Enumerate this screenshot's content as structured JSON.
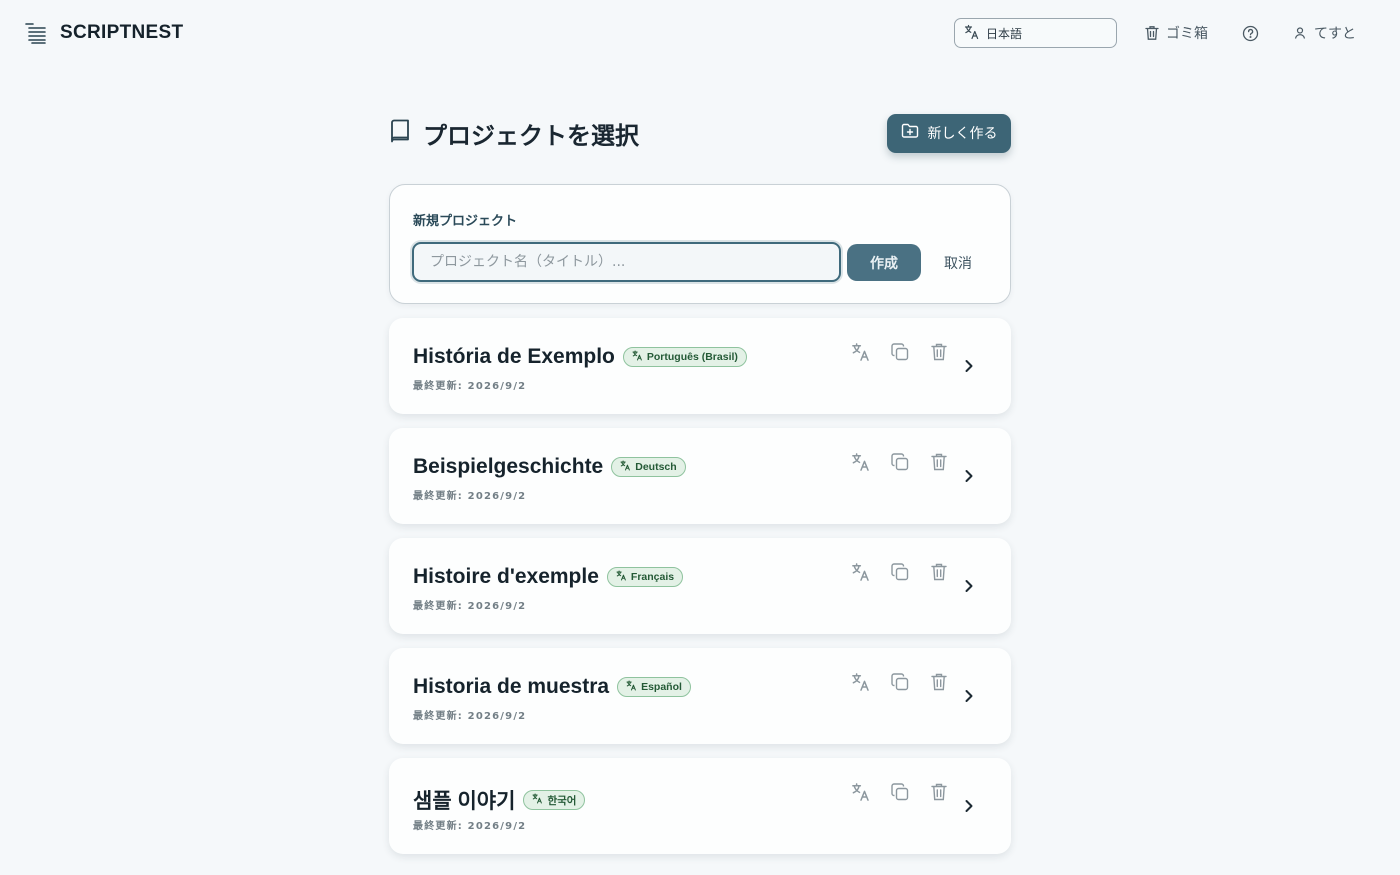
{
  "header": {
    "app_name": "SCRIPTNEST",
    "language_select": {
      "value": "日本語"
    },
    "trash_label": "ゴミ箱",
    "user_label": "てすと"
  },
  "page": {
    "title": "プロジェクトを選択",
    "new_button_label": "新しく作る"
  },
  "new_project": {
    "label": "新規プロジェクト",
    "input_placeholder": "プロジェクト名（タイトル）...",
    "input_value": "",
    "create_label": "作成",
    "cancel_label": "取消"
  },
  "projects": [
    {
      "title": "História de Exemplo",
      "language": "Português (Brasil)",
      "updated": "最終更新: 2026/9/2"
    },
    {
      "title": "Beispielgeschichte",
      "language": "Deutsch",
      "updated": "最終更新: 2026/9/2"
    },
    {
      "title": "Histoire d'exemple",
      "language": "Français",
      "updated": "最終更新: 2026/9/2"
    },
    {
      "title": "Historia de muestra",
      "language": "Español",
      "updated": "最終更新: 2026/9/2"
    },
    {
      "title": "샘플 이야기",
      "language": "한국어",
      "updated": "最終更新: 2026/9/2"
    }
  ],
  "colors": {
    "accent": "#3d6576",
    "background": "#f5f8fa",
    "badge_bg": "#e3f1e6",
    "badge_border": "#8fc39e"
  },
  "icons": {
    "brand": "stacked-lines-logo-icon",
    "language": "translate-icon",
    "trash": "trash-icon",
    "help": "help-circle-icon",
    "user": "user-icon",
    "book": "book-icon",
    "new_folder": "folder-plus-icon",
    "copy": "copy-icon",
    "chevron": "chevron-right-icon"
  }
}
